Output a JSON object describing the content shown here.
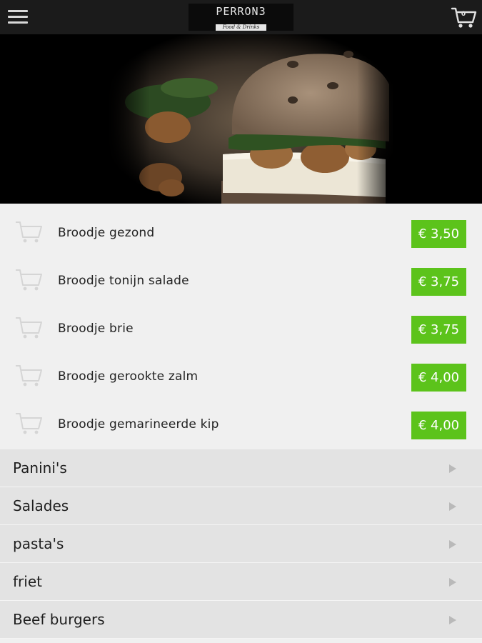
{
  "header": {
    "menu_icon": "hamburger-menu-icon",
    "logo_text": "PERRON3",
    "logo_subtext": "Food & Drinks",
    "cart_icon": "shopping-cart-icon",
    "cart_count": "0"
  },
  "hero": {
    "image": "sandwich-photo"
  },
  "products": [
    {
      "name": "Broodje gezond",
      "price": "€ 3,50",
      "icon": "cart-icon"
    },
    {
      "name": "Broodje tonijn salade",
      "price": "€ 3,75",
      "icon": "cart-icon"
    },
    {
      "name": "Broodje brie",
      "price": "€ 3,75",
      "icon": "cart-icon"
    },
    {
      "name": "Broodje gerookte zalm",
      "price": "€ 4,00",
      "icon": "cart-icon"
    },
    {
      "name": "Broodje gemarineerde kip",
      "price": "€ 4,00",
      "icon": "cart-icon"
    }
  ],
  "categories": [
    {
      "label": "Panini's",
      "icon": "chevron-right-icon"
    },
    {
      "label": "Salades",
      "icon": "chevron-right-icon"
    },
    {
      "label": "pasta's",
      "icon": "chevron-right-icon"
    },
    {
      "label": "friet",
      "icon": "chevron-right-icon"
    },
    {
      "label": "Beef burgers",
      "icon": "chevron-right-icon"
    }
  ],
  "colors": {
    "topbar": "#1b1b1b",
    "price_green": "#5cc31b",
    "list_bg": "#f0f0f0",
    "category_bg": "#e3e3e3"
  }
}
